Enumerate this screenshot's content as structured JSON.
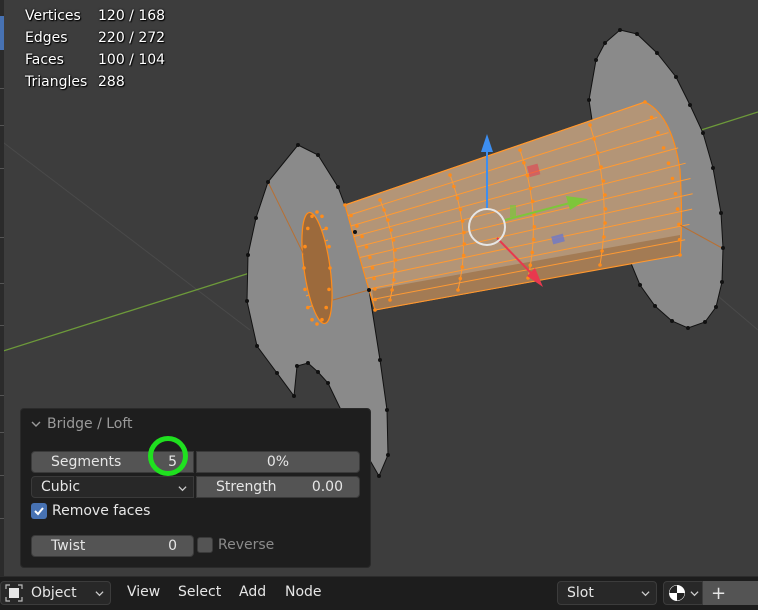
{
  "stats": [
    {
      "label": "Vertices",
      "value": "120 / 168"
    },
    {
      "label": "Edges",
      "value": "220 / 272"
    },
    {
      "label": "Faces",
      "value": "100 / 104"
    },
    {
      "label": "Triangles",
      "value": "288"
    }
  ],
  "operator_panel": {
    "title": "Bridge / Loft",
    "segments_label": "Segments",
    "segments_value": "5",
    "smoothness_value": "0%",
    "interpolation_value": "Cubic",
    "strength_label": "Strength",
    "strength_value": "0.00",
    "remove_faces_label": "Remove faces",
    "remove_faces_checked": true,
    "twist_label": "Twist",
    "twist_value": "0",
    "reverse_label": "Reverse",
    "reverse_checked": false
  },
  "header": {
    "mode": "Object",
    "menus": [
      "View",
      "Select",
      "Add",
      "Node"
    ],
    "slot": "Slot",
    "add_label": "+"
  },
  "colors": {
    "selection": "#ff8c1a",
    "highlight_annotation": "#1fe01f",
    "checkbox_on": "#4772b3",
    "gizmo_x": "#e8384e",
    "gizmo_y": "#7ec63a",
    "gizmo_z": "#3d8ef0"
  }
}
